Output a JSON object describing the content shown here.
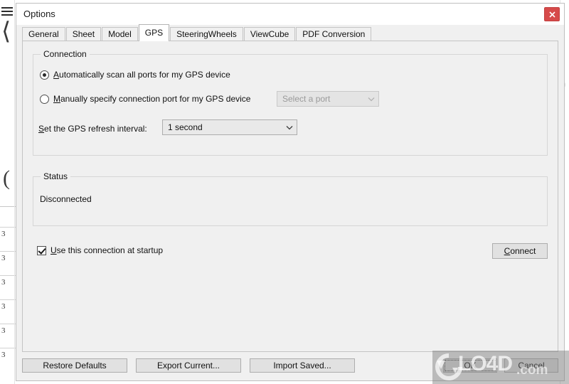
{
  "window": {
    "title": "Options",
    "close_icon": "close-icon",
    "close_glyph": "×",
    "close_color": "#d64a4a"
  },
  "tabs": [
    {
      "label": "General",
      "selected": false
    },
    {
      "label": "Sheet",
      "selected": false
    },
    {
      "label": "Model",
      "selected": false
    },
    {
      "label": "GPS",
      "selected": true
    },
    {
      "label": "SteeringWheels",
      "selected": false
    },
    {
      "label": "ViewCube",
      "selected": false
    },
    {
      "label": "PDF Conversion",
      "selected": false
    }
  ],
  "connection": {
    "group_title": "Connection",
    "auto_radio": {
      "accel": "A",
      "rest": "utomatically scan all ports for my GPS device",
      "checked": true
    },
    "manual_radio": {
      "accel": "M",
      "rest": "anually specify connection port for my GPS device",
      "checked": false
    },
    "port_combo": {
      "value": "Select a port",
      "placeholder": "Select a port",
      "disabled": true,
      "arrow_icon": "chevron-down-icon"
    },
    "interval_label": {
      "accel": "S",
      "rest": "et the GPS refresh interval:"
    },
    "interval_combo": {
      "value": "1 second",
      "disabled": false,
      "arrow_icon": "chevron-down-icon"
    }
  },
  "status": {
    "group_title": "Status",
    "value": "Disconnected"
  },
  "startup": {
    "checked": true,
    "accel": "U",
    "rest": "se this connection at startup"
  },
  "connect_button": {
    "accel": "C",
    "rest": "onnect"
  },
  "footer": {
    "restore_defaults": "Restore Defaults",
    "export_current": "Export Current...",
    "import_saved": "Import Saved...",
    "ok": "OK",
    "cancel": "Cancel"
  },
  "watermark": {
    "text": "LO4D",
    "domain": ".com",
    "logo_icon": "refresh-circle-icon"
  },
  "background": {
    "menu_icon": "hamburger-menu-icon",
    "ruler_numbers": [
      "3",
      "3",
      "3",
      "3",
      "3",
      "3"
    ],
    "paren_left": "⟨",
    "paren_mid": "(",
    "paren_right": ")"
  }
}
